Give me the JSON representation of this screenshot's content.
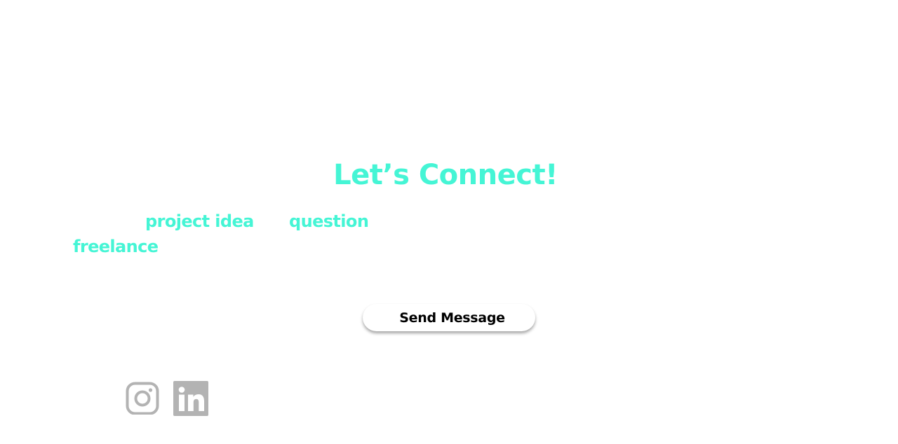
{
  "heading": {
    "title": "Let’s Connect!"
  },
  "topics": [
    {
      "label": "project idea"
    },
    {
      "label": "question"
    },
    {
      "label": "freelance"
    }
  ],
  "form": {
    "send_label": "Send Message"
  },
  "social": {
    "icons": [
      "instagram-icon",
      "linkedin-icon"
    ],
    "icon_color": "#B3B3B3"
  },
  "colors": {
    "accent": "#45F5D5",
    "background": "#FFFFFF",
    "button_text": "#000000"
  }
}
